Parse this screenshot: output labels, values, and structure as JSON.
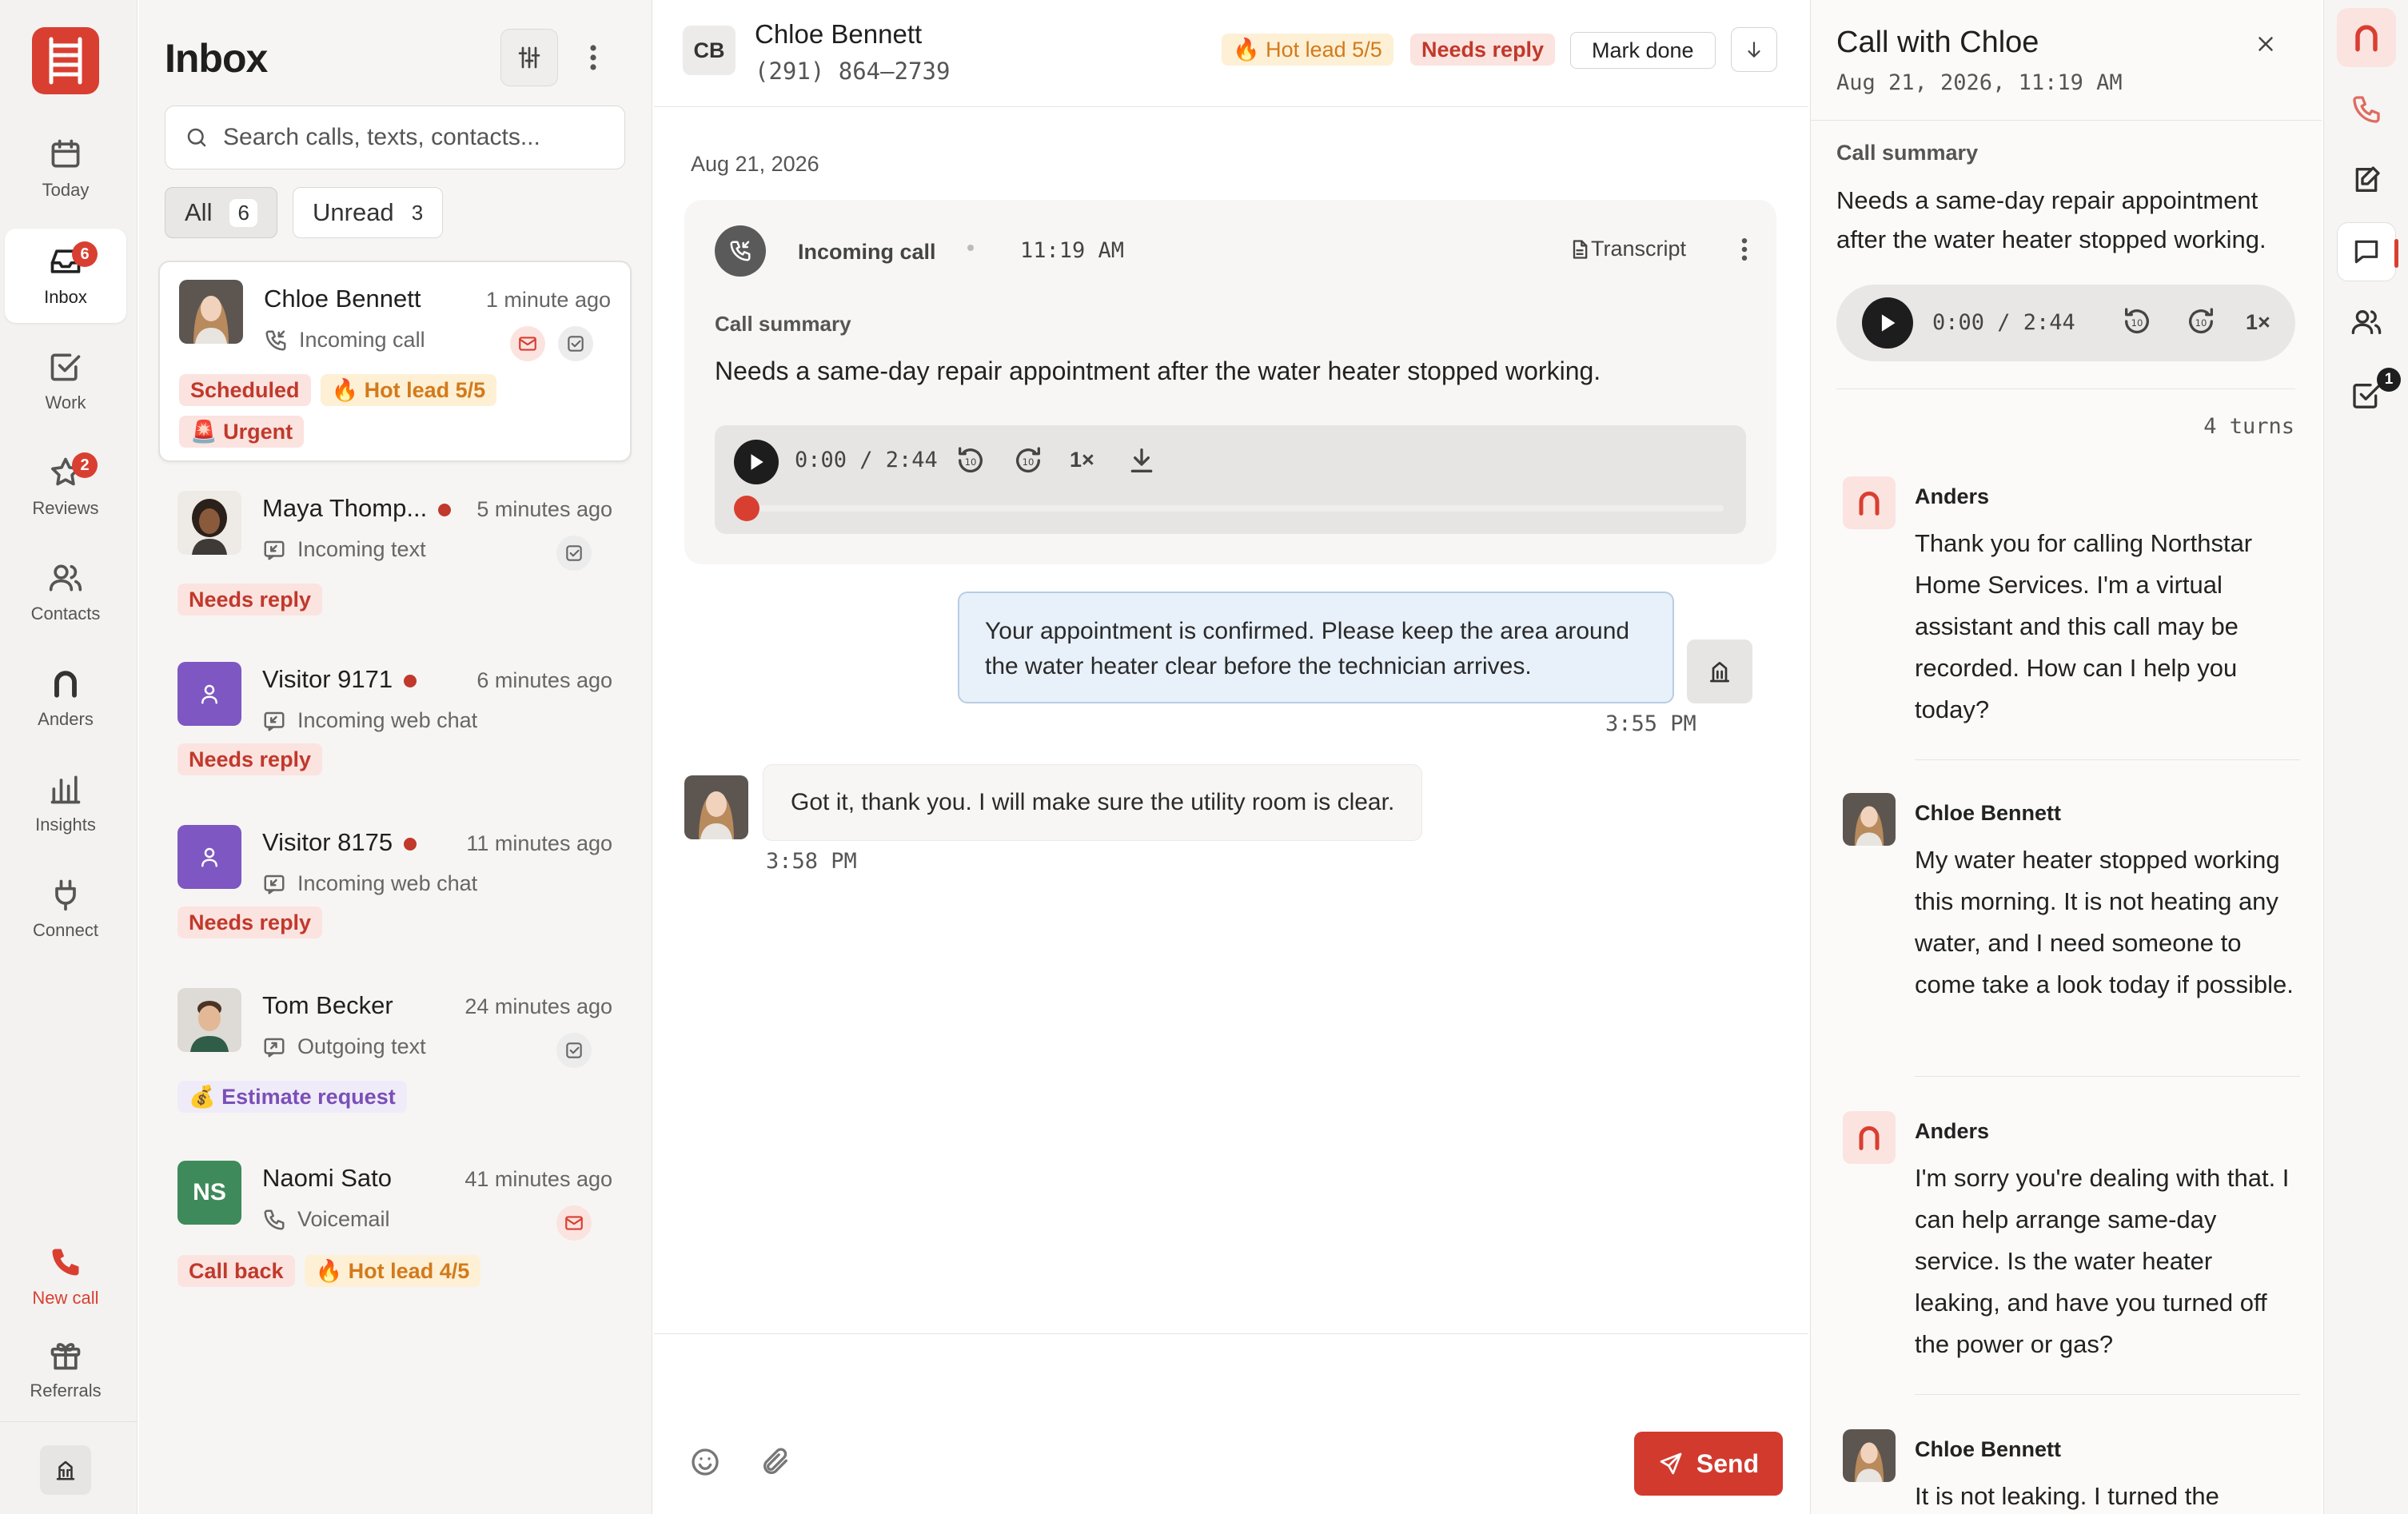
{
  "nav": {
    "items": [
      {
        "label": "Today",
        "icon": "calendar-icon"
      },
      {
        "label": "Inbox",
        "icon": "inbox-icon",
        "badge": "6",
        "active": true
      },
      {
        "label": "Work",
        "icon": "check-square-icon"
      },
      {
        "label": "Reviews",
        "icon": "star-icon",
        "badge": "2"
      },
      {
        "label": "Contacts",
        "icon": "users-icon"
      },
      {
        "label": "Anders",
        "icon": "anders-icon"
      },
      {
        "label": "Insights",
        "icon": "bar-chart-icon"
      },
      {
        "label": "Connect",
        "icon": "plug-icon"
      }
    ],
    "new_call": "New call",
    "referrals": "Referrals"
  },
  "inbox": {
    "title": "Inbox",
    "search_placeholder": "Search calls, texts, contacts...",
    "filters": {
      "all_label": "All",
      "all_count": "6",
      "unread_label": "Unread",
      "unread_count": "3"
    },
    "conversations": [
      {
        "name": "Chloe Bennett",
        "time": "1 minute ago",
        "subtitle": "Incoming call",
        "tags": [
          "Scheduled",
          "🔥 Hot lead 5/5",
          "🚨 Urgent"
        ]
      },
      {
        "name": "Maya Thomp...",
        "time": "5 minutes ago",
        "subtitle": "Incoming text",
        "tags": [
          "Needs reply"
        ]
      },
      {
        "name": "Visitor 9171",
        "time": "6 minutes ago",
        "subtitle": "Incoming web chat",
        "tags": [
          "Needs reply"
        ]
      },
      {
        "name": "Visitor 8175",
        "time": "11 minutes ago",
        "subtitle": "Incoming web chat",
        "tags": [
          "Needs reply"
        ]
      },
      {
        "name": "Tom Becker",
        "time": "24 minutes ago",
        "subtitle": "Outgoing text",
        "tags": [
          "💰 Estimate request"
        ]
      },
      {
        "name": "Naomi Sato",
        "initials": "NS",
        "time": "41 minutes ago",
        "subtitle": "Voicemail",
        "tags": [
          "Call back",
          "🔥 Hot lead 4/5"
        ]
      }
    ]
  },
  "conversation": {
    "initials": "CB",
    "name": "Chloe Bennett",
    "phone": "(291) 864–2739",
    "tags": {
      "hot_lead": "🔥 Hot lead 5/5",
      "needs_reply": "Needs reply"
    },
    "mark_done": "Mark done",
    "date": "Aug 21, 2026",
    "call": {
      "type": "Incoming call",
      "time": "11:19 AM",
      "transcript_label": "Transcript",
      "summary_label": "Call summary",
      "summary": "Needs a same-day repair appointment after the water heater stopped working.",
      "player_time": "0:00 / 2:44",
      "speed": "1×"
    },
    "outgoing": {
      "text": "Your appointment is confirmed. Please keep the area around the water heater clear before the technician arrives.",
      "time": "3:55 PM"
    },
    "incoming": {
      "text": "Got it, thank you. I will make sure the utility room is clear.",
      "time": "3:58 PM"
    },
    "composer_placeholder": "",
    "send_label": "Send"
  },
  "detail": {
    "title": "Call with Chloe",
    "date": "Aug 21, 2026, 11:19 AM",
    "summary_label": "Call summary",
    "summary": "Needs a same-day repair appointment after the water heater stopped working.",
    "player_time": "0:00 / 2:44",
    "speed": "1×",
    "turns_count": "4 turns",
    "turns": [
      {
        "speaker": "Anders",
        "text": "Thank you for calling Northstar Home Services. I'm a virtual assistant and this call may be recorded. How can I help you today?"
      },
      {
        "speaker": "Chloe Bennett",
        "text": "My water heater stopped working this morning. It is not heating any water, and I need someone to come take a look today if possible."
      },
      {
        "speaker": "Anders",
        "text": "I'm sorry you're dealing with that. I can help arrange same-day service. Is the water heater leaking, and have you turned off the power or gas?"
      },
      {
        "speaker": "Chloe Bennett",
        "text": "It is not leaking. I turned the"
      }
    ]
  },
  "app_rail": {
    "tasks_badge": "1"
  },
  "colors": {
    "brand": "#d93f31",
    "hot_lead": "#d37a1b",
    "needs_reply": "#c0392b",
    "estimate": "#7a4fb8",
    "visitor_avatar": "#7e57c2",
    "naomi_avatar": "#3f8a5a"
  }
}
